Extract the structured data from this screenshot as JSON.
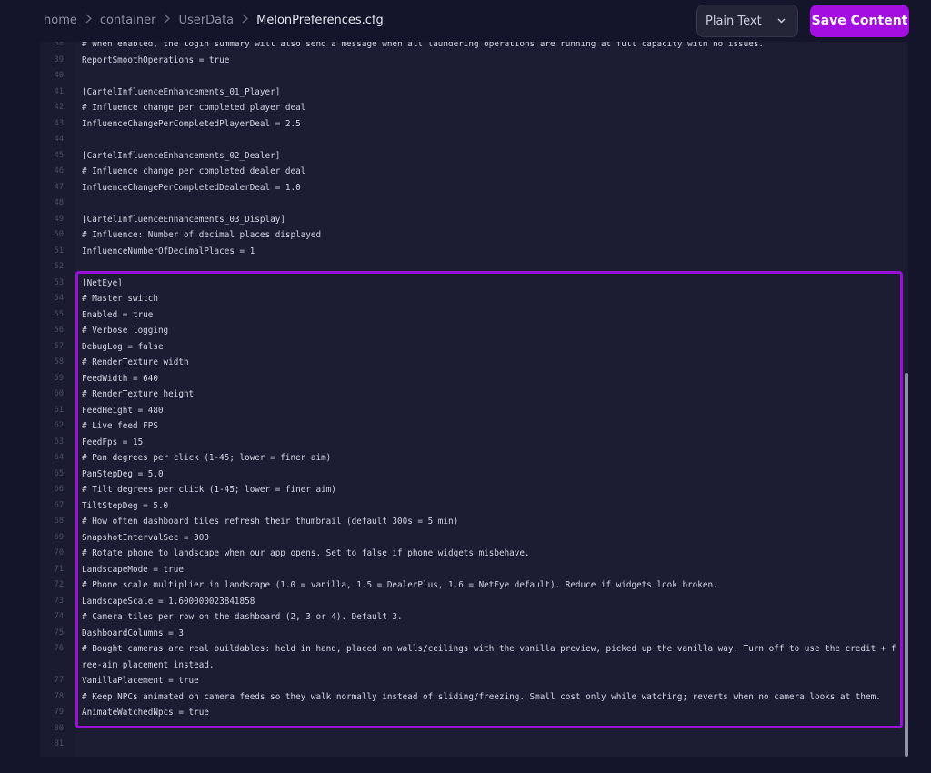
{
  "breadcrumb": {
    "items": [
      "home",
      "container",
      "UserData"
    ],
    "current": "MelonPreferences.cfg"
  },
  "format_select": {
    "value": "Plain Text"
  },
  "save_button": {
    "label": "Save Content"
  },
  "editor": {
    "lines": [
      {
        "n": "38",
        "t": "# When enabled, the login summary will also send a message when all laundering operations are running at full capacity with no issues."
      },
      {
        "n": "39",
        "t": "ReportSmoothOperations = true"
      },
      {
        "n": "40",
        "t": ""
      },
      {
        "n": "41",
        "t": "[CartelInfluenceEnhancements_01_Player]"
      },
      {
        "n": "42",
        "t": "# Influence change per completed player deal"
      },
      {
        "n": "43",
        "t": "InfluenceChangePerCompletedPlayerDeal = 2.5"
      },
      {
        "n": "44",
        "t": ""
      },
      {
        "n": "45",
        "t": "[CartelInfluenceEnhancements_02_Dealer]"
      },
      {
        "n": "46",
        "t": "# Influence change per completed dealer deal"
      },
      {
        "n": "47",
        "t": "InfluenceChangePerCompletedDealerDeal = 1.0"
      },
      {
        "n": "48",
        "t": ""
      },
      {
        "n": "49",
        "t": "[CartelInfluenceEnhancements_03_Display]"
      },
      {
        "n": "50",
        "t": "# Influence: Number of decimal places displayed"
      },
      {
        "n": "51",
        "t": "InfluenceNumberOfDecimalPlaces = 1"
      },
      {
        "n": "52",
        "t": ""
      },
      {
        "n": "53",
        "t": "[NetEye]"
      },
      {
        "n": "54",
        "t": "# Master switch"
      },
      {
        "n": "55",
        "t": "Enabled = true"
      },
      {
        "n": "56",
        "t": "# Verbose logging"
      },
      {
        "n": "57",
        "t": "DebugLog = false"
      },
      {
        "n": "58",
        "t": "# RenderTexture width"
      },
      {
        "n": "59",
        "t": "FeedWidth = 640"
      },
      {
        "n": "60",
        "t": "# RenderTexture height"
      },
      {
        "n": "61",
        "t": "FeedHeight = 480"
      },
      {
        "n": "62",
        "t": "# Live feed FPS"
      },
      {
        "n": "63",
        "t": "FeedFps = 15"
      },
      {
        "n": "64",
        "t": "# Pan degrees per click (1-45; lower = finer aim)"
      },
      {
        "n": "65",
        "t": "PanStepDeg = 5.0"
      },
      {
        "n": "66",
        "t": "# Tilt degrees per click (1-45; lower = finer aim)"
      },
      {
        "n": "67",
        "t": "TiltStepDeg = 5.0"
      },
      {
        "n": "68",
        "t": "# How often dashboard tiles refresh their thumbnail (default 300s = 5 min)"
      },
      {
        "n": "69",
        "t": "SnapshotIntervalSec = 300"
      },
      {
        "n": "70",
        "t": "# Rotate phone to landscape when our app opens. Set to false if phone widgets misbehave."
      },
      {
        "n": "71",
        "t": "LandscapeMode = true"
      },
      {
        "n": "72",
        "t": "# Phone scale multiplier in landscape (1.0 = vanilla, 1.5 = DealerPlus, 1.6 = NetEye default). Reduce if widgets look broken."
      },
      {
        "n": "73",
        "t": "LandscapeScale = 1.600000023841858"
      },
      {
        "n": "74",
        "t": "# Camera tiles per row on the dashboard (2, 3 or 4). Default 3."
      },
      {
        "n": "75",
        "t": "DashboardColumns = 3"
      },
      {
        "n": "76",
        "t": "# Bought cameras are real buildables: held in hand, placed on walls/ceilings with the vanilla preview, picked up the vanilla way. Turn off to use the credit + free-aim placement instead."
      },
      {
        "n": "77",
        "t": "VanillaPlacement = true"
      },
      {
        "n": "78",
        "t": "# Keep NPCs animated on camera feeds so they walk normally instead of sliding/freezing. Small cost only while watching; reverts when no camera looks at them."
      },
      {
        "n": "79",
        "t": "AnimateWatchedNpcs = true"
      },
      {
        "n": "80",
        "t": ""
      },
      {
        "n": "81",
        "t": ""
      }
    ]
  },
  "colors": {
    "accent": "#a30fe0",
    "highlight_border": "#9a10d6",
    "background": "#14142a",
    "editor_bg": "#1c1d33"
  },
  "icons": {
    "breadcrumb_separator": "chevron-right-icon",
    "select_arrow": "chevron-down-icon"
  }
}
